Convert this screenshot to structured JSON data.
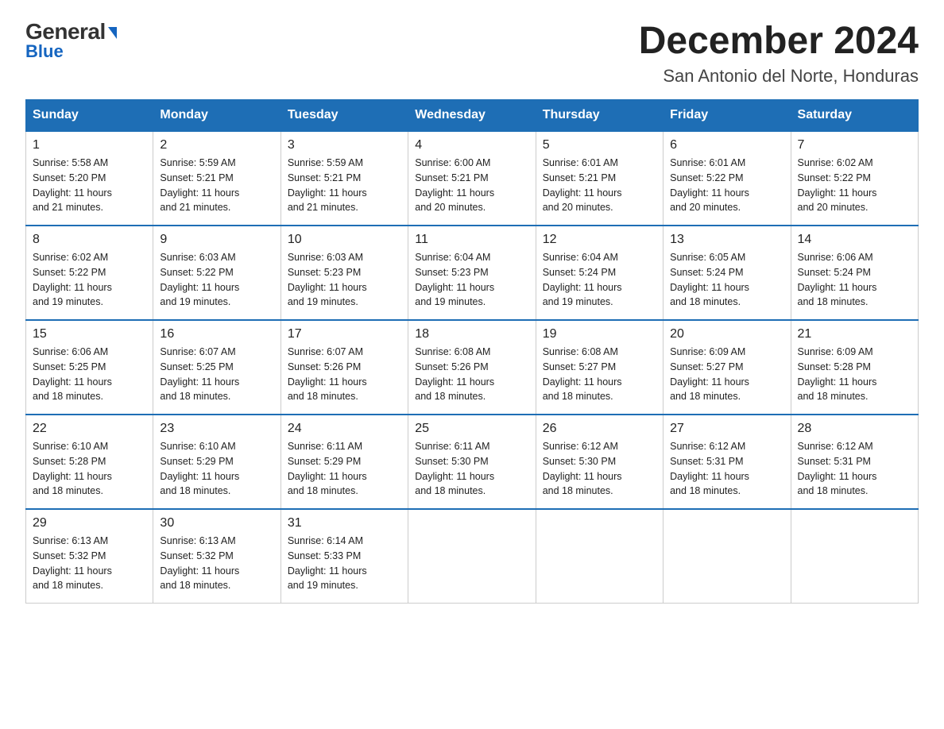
{
  "logo": {
    "general": "General",
    "arrow": "▶",
    "blue": "Blue"
  },
  "header": {
    "title": "December 2024",
    "subtitle": "San Antonio del Norte, Honduras"
  },
  "days_of_week": [
    "Sunday",
    "Monday",
    "Tuesday",
    "Wednesday",
    "Thursday",
    "Friday",
    "Saturday"
  ],
  "weeks": [
    [
      {
        "day": "1",
        "sunrise": "5:58 AM",
        "sunset": "5:20 PM",
        "daylight": "11 hours and 21 minutes."
      },
      {
        "day": "2",
        "sunrise": "5:59 AM",
        "sunset": "5:21 PM",
        "daylight": "11 hours and 21 minutes."
      },
      {
        "day": "3",
        "sunrise": "5:59 AM",
        "sunset": "5:21 PM",
        "daylight": "11 hours and 21 minutes."
      },
      {
        "day": "4",
        "sunrise": "6:00 AM",
        "sunset": "5:21 PM",
        "daylight": "11 hours and 20 minutes."
      },
      {
        "day": "5",
        "sunrise": "6:01 AM",
        "sunset": "5:21 PM",
        "daylight": "11 hours and 20 minutes."
      },
      {
        "day": "6",
        "sunrise": "6:01 AM",
        "sunset": "5:22 PM",
        "daylight": "11 hours and 20 minutes."
      },
      {
        "day": "7",
        "sunrise": "6:02 AM",
        "sunset": "5:22 PM",
        "daylight": "11 hours and 20 minutes."
      }
    ],
    [
      {
        "day": "8",
        "sunrise": "6:02 AM",
        "sunset": "5:22 PM",
        "daylight": "11 hours and 19 minutes."
      },
      {
        "day": "9",
        "sunrise": "6:03 AM",
        "sunset": "5:22 PM",
        "daylight": "11 hours and 19 minutes."
      },
      {
        "day": "10",
        "sunrise": "6:03 AM",
        "sunset": "5:23 PM",
        "daylight": "11 hours and 19 minutes."
      },
      {
        "day": "11",
        "sunrise": "6:04 AM",
        "sunset": "5:23 PM",
        "daylight": "11 hours and 19 minutes."
      },
      {
        "day": "12",
        "sunrise": "6:04 AM",
        "sunset": "5:24 PM",
        "daylight": "11 hours and 19 minutes."
      },
      {
        "day": "13",
        "sunrise": "6:05 AM",
        "sunset": "5:24 PM",
        "daylight": "11 hours and 18 minutes."
      },
      {
        "day": "14",
        "sunrise": "6:06 AM",
        "sunset": "5:24 PM",
        "daylight": "11 hours and 18 minutes."
      }
    ],
    [
      {
        "day": "15",
        "sunrise": "6:06 AM",
        "sunset": "5:25 PM",
        "daylight": "11 hours and 18 minutes."
      },
      {
        "day": "16",
        "sunrise": "6:07 AM",
        "sunset": "5:25 PM",
        "daylight": "11 hours and 18 minutes."
      },
      {
        "day": "17",
        "sunrise": "6:07 AM",
        "sunset": "5:26 PM",
        "daylight": "11 hours and 18 minutes."
      },
      {
        "day": "18",
        "sunrise": "6:08 AM",
        "sunset": "5:26 PM",
        "daylight": "11 hours and 18 minutes."
      },
      {
        "day": "19",
        "sunrise": "6:08 AM",
        "sunset": "5:27 PM",
        "daylight": "11 hours and 18 minutes."
      },
      {
        "day": "20",
        "sunrise": "6:09 AM",
        "sunset": "5:27 PM",
        "daylight": "11 hours and 18 minutes."
      },
      {
        "day": "21",
        "sunrise": "6:09 AM",
        "sunset": "5:28 PM",
        "daylight": "11 hours and 18 minutes."
      }
    ],
    [
      {
        "day": "22",
        "sunrise": "6:10 AM",
        "sunset": "5:28 PM",
        "daylight": "11 hours and 18 minutes."
      },
      {
        "day": "23",
        "sunrise": "6:10 AM",
        "sunset": "5:29 PM",
        "daylight": "11 hours and 18 minutes."
      },
      {
        "day": "24",
        "sunrise": "6:11 AM",
        "sunset": "5:29 PM",
        "daylight": "11 hours and 18 minutes."
      },
      {
        "day": "25",
        "sunrise": "6:11 AM",
        "sunset": "5:30 PM",
        "daylight": "11 hours and 18 minutes."
      },
      {
        "day": "26",
        "sunrise": "6:12 AM",
        "sunset": "5:30 PM",
        "daylight": "11 hours and 18 minutes."
      },
      {
        "day": "27",
        "sunrise": "6:12 AM",
        "sunset": "5:31 PM",
        "daylight": "11 hours and 18 minutes."
      },
      {
        "day": "28",
        "sunrise": "6:12 AM",
        "sunset": "5:31 PM",
        "daylight": "11 hours and 18 minutes."
      }
    ],
    [
      {
        "day": "29",
        "sunrise": "6:13 AM",
        "sunset": "5:32 PM",
        "daylight": "11 hours and 18 minutes."
      },
      {
        "day": "30",
        "sunrise": "6:13 AM",
        "sunset": "5:32 PM",
        "daylight": "11 hours and 18 minutes."
      },
      {
        "day": "31",
        "sunrise": "6:14 AM",
        "sunset": "5:33 PM",
        "daylight": "11 hours and 19 minutes."
      },
      null,
      null,
      null,
      null
    ]
  ],
  "labels": {
    "sunrise": "Sunrise:",
    "sunset": "Sunset:",
    "daylight": "Daylight:"
  },
  "colors": {
    "header_bg": "#1e6eb5",
    "accent": "#1565c0"
  }
}
